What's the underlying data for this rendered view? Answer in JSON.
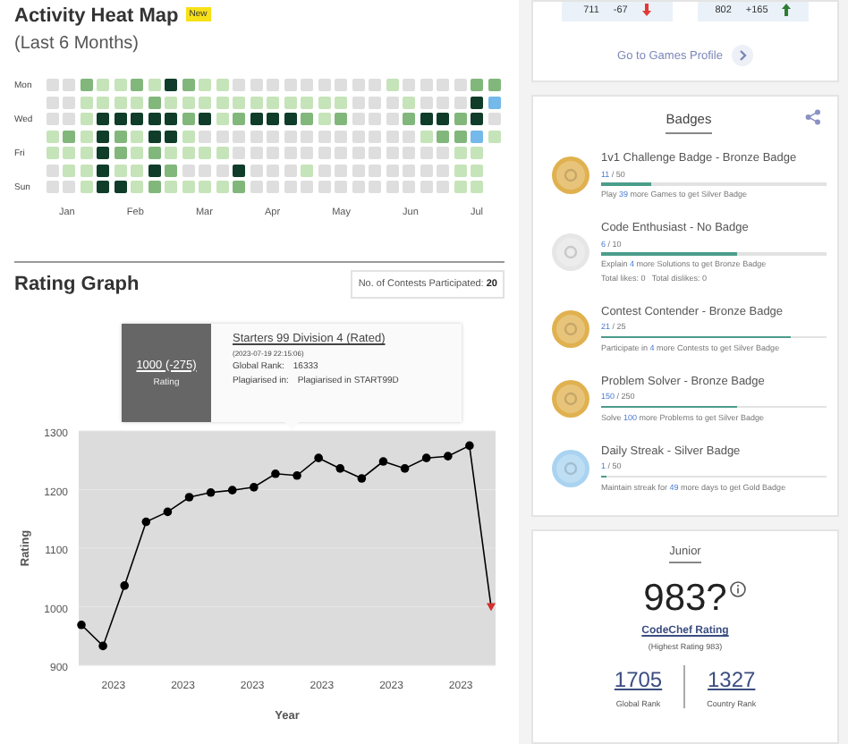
{
  "activity_heat_map": {
    "title": "Activity Heat Map",
    "badge": "New",
    "subtitle": "(Last 6 Months)",
    "days": [
      {
        "label": "Mon",
        "cells": [
          {
            "color": "#dedede"
          },
          {
            "color": "#dedede"
          },
          {
            "color": "#82b77c"
          },
          {
            "color": "#c6e4b9"
          },
          {
            "color": "#c6e4b9"
          },
          {
            "color": "#82b77c"
          },
          {
            "color": "#c6e4b9"
          },
          {
            "color": "#0f3d2a"
          },
          {
            "color": "#82b77c"
          },
          {
            "color": "#c6e4b9"
          },
          {
            "color": "#c6e4b9"
          },
          {
            "color": "#dedede"
          },
          {
            "color": "#dedede"
          },
          {
            "color": "#dedede"
          },
          {
            "color": "#dedede"
          },
          {
            "color": "#dedede"
          },
          {
            "color": "#dedede"
          },
          {
            "color": "#dedede"
          },
          {
            "color": "#dedede"
          },
          {
            "color": "#dedede"
          },
          {
            "color": "#c6e4b9"
          },
          {
            "color": "#dedede"
          },
          {
            "color": "#dedede"
          },
          {
            "color": "#dedede"
          },
          {
            "color": "#dedede"
          },
          {
            "color": "#82b77c"
          },
          {
            "color": "#82b77c"
          }
        ]
      },
      {
        "cells": [
          {
            "color": "#dedede"
          },
          {
            "color": "#dedede"
          },
          {
            "color": "#c6e4b9"
          },
          {
            "color": "#c6e4b9"
          },
          {
            "color": "#c6e4b9"
          },
          {
            "color": "#c6e4b9"
          },
          {
            "color": "#82b77c"
          },
          {
            "color": "#c6e4b9"
          },
          {
            "color": "#c6e4b9"
          },
          {
            "color": "#c6e4b9"
          },
          {
            "color": "#c6e4b9"
          },
          {
            "color": "#c6e4b9"
          },
          {
            "color": "#c6e4b9"
          },
          {
            "color": "#c6e4b9"
          },
          {
            "color": "#c6e4b9"
          },
          {
            "color": "#c6e4b9"
          },
          {
            "color": "#c6e4b9"
          },
          {
            "color": "#c6e4b9"
          },
          {
            "color": "#dedede"
          },
          {
            "color": "#dedede"
          },
          {
            "color": "#dedede"
          },
          {
            "color": "#c6e4b9"
          },
          {
            "color": "#dedede"
          },
          {
            "color": "#dedede"
          },
          {
            "color": "#dedede"
          },
          {
            "color": "#0f3d2a"
          },
          {
            "color": "#74b9ea"
          }
        ]
      },
      {
        "label": "Wed",
        "cells": [
          {
            "color": "#dedede"
          },
          {
            "color": "#dedede"
          },
          {
            "color": "#c6e4b9"
          },
          {
            "color": "#0f3d2a"
          },
          {
            "color": "#0f3d2a"
          },
          {
            "color": "#0f3d2a"
          },
          {
            "color": "#0f3d2a"
          },
          {
            "color": "#0f3d2a"
          },
          {
            "color": "#82b77c"
          },
          {
            "color": "#0f3d2a"
          },
          {
            "color": "#c6e4b9"
          },
          {
            "color": "#82b77c"
          },
          {
            "color": "#0f3d2a"
          },
          {
            "color": "#0f3d2a"
          },
          {
            "color": "#0f3d2a"
          },
          {
            "color": "#82b77c"
          },
          {
            "color": "#c6e4b9"
          },
          {
            "color": "#82b77c"
          },
          {
            "color": "#dedede"
          },
          {
            "color": "#dedede"
          },
          {
            "color": "#dedede"
          },
          {
            "color": "#82b77c"
          },
          {
            "color": "#0f3d2a"
          },
          {
            "color": "#0f3d2a"
          },
          {
            "color": "#82b77c"
          },
          {
            "color": "#0f3d2a"
          },
          {
            "color": "#dedede"
          }
        ]
      },
      {
        "cells": [
          {
            "color": "#c6e4b9"
          },
          {
            "color": "#82b77c"
          },
          {
            "color": "#c6e4b9"
          },
          {
            "color": "#0f3d2a"
          },
          {
            "color": "#82b77c"
          },
          {
            "color": "#c6e4b9"
          },
          {
            "color": "#0f3d2a"
          },
          {
            "color": "#0f3d2a"
          },
          {
            "color": "#c6e4b9"
          },
          {
            "color": "#dedede"
          },
          {
            "color": "#dedede"
          },
          {
            "color": "#dedede"
          },
          {
            "color": "#dedede"
          },
          {
            "color": "#dedede"
          },
          {
            "color": "#dedede"
          },
          {
            "color": "#dedede"
          },
          {
            "color": "#dedede"
          },
          {
            "color": "#dedede"
          },
          {
            "color": "#dedede"
          },
          {
            "color": "#dedede"
          },
          {
            "color": "#dedede"
          },
          {
            "color": "#dedede"
          },
          {
            "color": "#c6e4b9"
          },
          {
            "color": "#82b77c"
          },
          {
            "color": "#82b77c"
          },
          {
            "color": "#74b9ea"
          },
          {
            "color": "#c6e4b9"
          }
        ]
      },
      {
        "label": "Fri",
        "cells": [
          {
            "color": "#c6e4b9"
          },
          {
            "color": "#c6e4b9"
          },
          {
            "color": "#c6e4b9"
          },
          {
            "color": "#0f3d2a"
          },
          {
            "color": "#82b77c"
          },
          {
            "color": "#c6e4b9"
          },
          {
            "color": "#82b77c"
          },
          {
            "color": "#c6e4b9"
          },
          {
            "color": "#c6e4b9"
          },
          {
            "color": "#c6e4b9"
          },
          {
            "color": "#c6e4b9"
          },
          {
            "color": "#dedede"
          },
          {
            "color": "#dedede"
          },
          {
            "color": "#dedede"
          },
          {
            "color": "#dedede"
          },
          {
            "color": "#dedede"
          },
          {
            "color": "#dedede"
          },
          {
            "color": "#dedede"
          },
          {
            "color": "#dedede"
          },
          {
            "color": "#dedede"
          },
          {
            "color": "#dedede"
          },
          {
            "color": "#dedede"
          },
          {
            "color": "#dedede"
          },
          {
            "color": "#dedede"
          },
          {
            "color": "#c6e4b9"
          },
          {
            "color": "#c6e4b9"
          }
        ]
      },
      {
        "cells": [
          {
            "color": "#dedede"
          },
          {
            "color": "#c6e4b9"
          },
          {
            "color": "#c6e4b9"
          },
          {
            "color": "#0f3d2a"
          },
          {
            "color": "#c6e4b9"
          },
          {
            "color": "#c6e4b9"
          },
          {
            "color": "#0f3d2a"
          },
          {
            "color": "#82b77c"
          },
          {
            "color": "#dedede"
          },
          {
            "color": "#dedede"
          },
          {
            "color": "#dedede"
          },
          {
            "color": "#0f3d2a"
          },
          {
            "color": "#dedede"
          },
          {
            "color": "#dedede"
          },
          {
            "color": "#dedede"
          },
          {
            "color": "#c6e4b9"
          },
          {
            "color": "#dedede"
          },
          {
            "color": "#dedede"
          },
          {
            "color": "#dedede"
          },
          {
            "color": "#dedede"
          },
          {
            "color": "#dedede"
          },
          {
            "color": "#dedede"
          },
          {
            "color": "#dedede"
          },
          {
            "color": "#dedede"
          },
          {
            "color": "#c6e4b9"
          },
          {
            "color": "#c6e4b9"
          }
        ]
      },
      {
        "label": "Sun",
        "cells": [
          {
            "color": "#dedede"
          },
          {
            "color": "#dedede"
          },
          {
            "color": "#c6e4b9"
          },
          {
            "color": "#0f3d2a"
          },
          {
            "color": "#0f3d2a"
          },
          {
            "color": "#c6e4b9"
          },
          {
            "color": "#82b77c"
          },
          {
            "color": "#c6e4b9"
          },
          {
            "color": "#c6e4b9"
          },
          {
            "color": "#c6e4b9"
          },
          {
            "color": "#c6e4b9"
          },
          {
            "color": "#82b77c"
          },
          {
            "color": "#dedede"
          },
          {
            "color": "#dedede"
          },
          {
            "color": "#dedede"
          },
          {
            "color": "#dedede"
          },
          {
            "color": "#dedede"
          },
          {
            "color": "#dedede"
          },
          {
            "color": "#dedede"
          },
          {
            "color": "#dedede"
          },
          {
            "color": "#dedede"
          },
          {
            "color": "#dedede"
          },
          {
            "color": "#dedede"
          },
          {
            "color": "#dedede"
          },
          {
            "color": "#c6e4b9"
          },
          {
            "color": "#c6e4b9"
          }
        ]
      }
    ],
    "months": [
      "Jan",
      "Feb",
      "Mar",
      "Apr",
      "May",
      "Jun",
      "Jul"
    ]
  },
  "rating_graph": {
    "title": "Rating Graph",
    "contests_label": "No. of Contests Participated:",
    "contests_count": "20",
    "tooltip": {
      "rating": "1000 (-275)",
      "rating_label": "Rating",
      "contest": "Starters 99 Division 4 (Rated)",
      "date": "(2023-07-19 22:15:06)",
      "rank_label": "Global Rank:",
      "rank": "16333",
      "plagiarism_label": "Plagiarised in:",
      "plagiarism": "Plagiarised in START99D"
    },
    "chart_data": {
      "type": "line",
      "xlabel": "Year",
      "ylabel": "Rating",
      "categories": [
        null,
        null,
        null,
        null,
        null,
        null,
        null,
        null,
        null,
        null,
        null,
        null,
        null,
        null,
        null,
        null,
        null,
        null,
        null,
        null
      ],
      "series": [
        {
          "color": "#000000",
          "marker": "circle",
          "values": [
            969,
            933,
            1036,
            1145,
            1162,
            1187,
            1195,
            1199,
            1204,
            1227,
            1224,
            1254,
            1236,
            1219,
            1248,
            1236,
            1254,
            1257,
            1275,
            1000
          ]
        }
      ],
      "ylim": [
        900,
        1300
      ],
      "yticks": [
        900,
        1000,
        1100,
        1200,
        1300
      ]
    },
    "year_labels": [
      "2023",
      "2023",
      "2023",
      "2023",
      "2023",
      "2023"
    ]
  },
  "games_card": {
    "stats": [
      {
        "rating": "711",
        "change": "-67",
        "rising": false
      },
      {
        "rating": "802",
        "change": "+165",
        "rising": true
      }
    ],
    "link": "Go to Games Profile"
  },
  "badges": {
    "title": "Badges",
    "items": [
      {
        "title": "1v1 Challenge Badge - Bronze Badge",
        "color": "#e0b14f",
        "current": "11",
        "total": "/ 50",
        "level": 0.22,
        "hint_before": "Play ",
        "hint_number": "39",
        "hint_after": " more Games to get Silver Badge"
      },
      {
        "title": "Code Enthusiast - No Badge",
        "color": "#e6e6e6",
        "current": "6",
        "total": "/ 10",
        "level": 0.6,
        "hint_before": "Explain ",
        "hint_number": "4",
        "hint_after": " more Solutions to get Bronze Badge",
        "extra": "Total likes: 0   Total dislikes: 0"
      },
      {
        "title": "Contest Contender - Bronze Badge",
        "color": "#e0b14f",
        "current": "21",
        "total": "/ 25",
        "level": 0.84,
        "hint_before": "Participate in ",
        "hint_number": "4",
        "hint_after": " more Contests to get Silver Badge"
      },
      {
        "title": "Problem Solver - Bronze Badge",
        "color": "#e0b14f",
        "current": "150",
        "total": "/ 250",
        "level": 0.6,
        "hint_before": "Solve ",
        "hint_number": "100",
        "hint_after": " more Problems to get Silver Badge"
      },
      {
        "title": "Daily Streak - Silver Badge",
        "color": "#a9d3f0",
        "current": "1",
        "total": "/ 50",
        "level": 0.02,
        "hint_before": "Maintain streak for ",
        "hint_number": "49",
        "hint_after": " more days to get Gold Badge"
      }
    ]
  },
  "rating_card": {
    "division": "Junior",
    "rating": "983?",
    "rating_link": "CodeChef Rating",
    "highest": "(Highest Rating 983)",
    "ranks": [
      {
        "value": "1705",
        "label": "Global Rank"
      },
      {
        "value": "1327",
        "label": "Country Rank"
      }
    ]
  }
}
